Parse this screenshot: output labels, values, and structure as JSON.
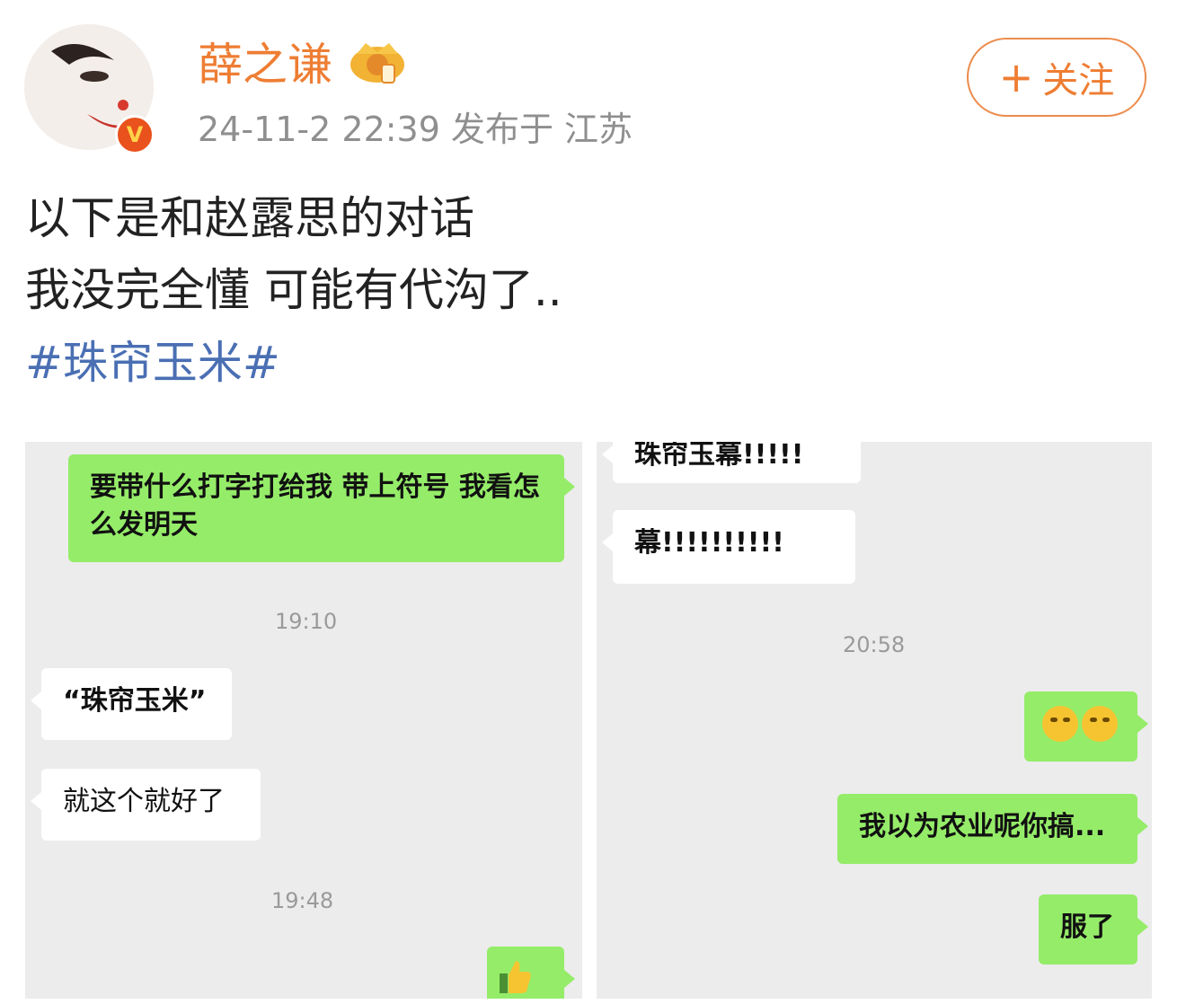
{
  "post": {
    "author": "薛之谦",
    "meta": "24-11-2 22:39  发布于 江苏",
    "follow_label": "关注",
    "lines": [
      "以下是和赵露思的对话",
      "我没完全懂 可能有代沟了.."
    ],
    "hashtag": "#珠帘玉米#"
  },
  "chat_left": {
    "msg1": "要带什么打字打给我 带上符号 我看怎么发明天",
    "time1": "19:10",
    "msg2": "“珠帘玉米”",
    "msg3": "就这个就好了",
    "time2": "19:48"
  },
  "chat_right": {
    "msg1": "珠帘玉幕!!!!!",
    "msg2": "幕!!!!!!!!!!",
    "time1": "20:58",
    "msg4": "我以为农业呢你搞...",
    "msg5": "服了"
  },
  "icons": {
    "plus": "plus-icon",
    "verified": "verified-badge-icon",
    "crown": "crown-icon",
    "thumbs_up": "thumbs-up-icon"
  },
  "colors": {
    "username": "#ee7d33",
    "hashtag": "#4a6fb3",
    "my_bubble": "#95ec69",
    "chat_bg": "#ececec"
  }
}
